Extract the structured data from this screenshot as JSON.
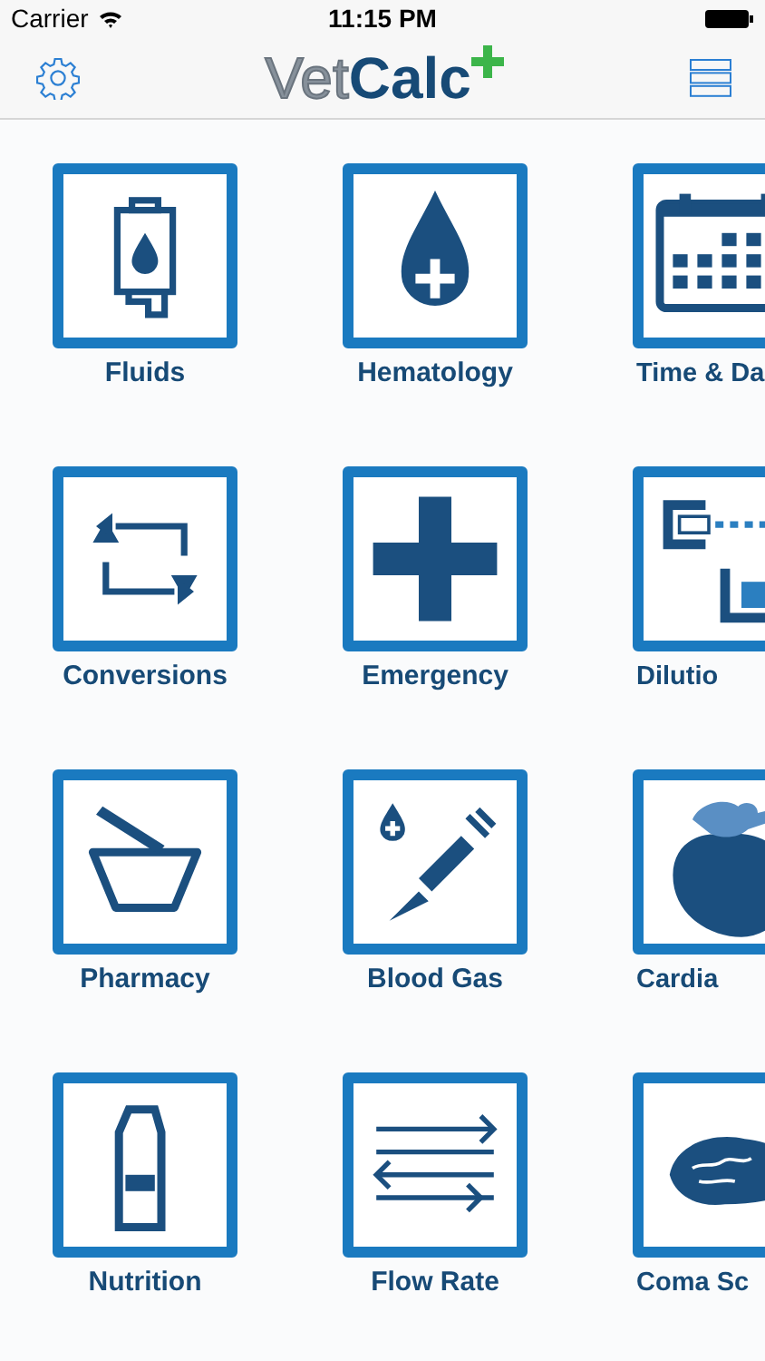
{
  "status_bar": {
    "carrier": "Carrier",
    "time": "11:15 PM"
  },
  "nav_bar": {
    "logo": "Vet**Calc**"
  },
  "tiles": [
    {
      "label": "Fluids"
    },
    {
      "label": "Hematology"
    },
    {
      "label": "Time & Da"
    },
    {
      "label": "Conversions"
    },
    {
      "label": "Emergency"
    },
    {
      "label": "Dilutio"
    },
    {
      "label": "Pharmacy"
    },
    {
      "label": "Blood Gas"
    },
    {
      "label": "Cardia"
    },
    {
      "label": "Nutrition"
    },
    {
      "label": "Flow Rate"
    },
    {
      "label": "Coma Sc"
    }
  ]
}
